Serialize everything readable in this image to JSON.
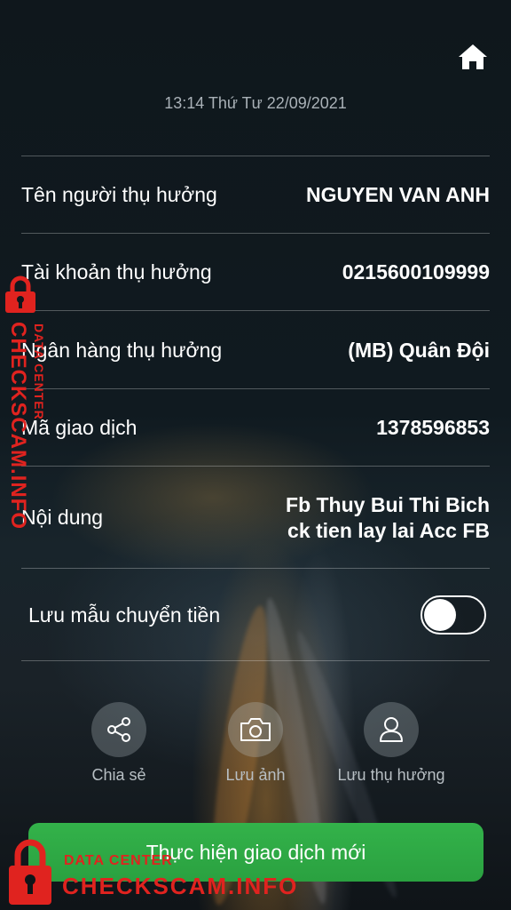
{
  "header": {
    "home_icon": "home-icon",
    "datetime": "13:14 Thứ Tư 22/09/2021"
  },
  "details": [
    {
      "label": "Tên người thụ hưởng",
      "value": "NGUYEN VAN ANH"
    },
    {
      "label": "Tài khoản thụ hưởng",
      "value": "0215600109999"
    },
    {
      "label": "Ngân hàng thụ hưởng",
      "value": "(MB) Quân Đội"
    },
    {
      "label": "Mã giao dịch",
      "value": "1378596853"
    },
    {
      "label": "Nội dung",
      "value_line1": "Fb Thuy Bui Thi Bich",
      "value_line2": "ck tien lay lai Acc FB"
    }
  ],
  "save_template": {
    "label": "Lưu mẫu chuyển tiền",
    "enabled": false
  },
  "actions": [
    {
      "icon": "share-icon",
      "label": "Chia sẻ"
    },
    {
      "icon": "camera-icon",
      "label": "Lưu ảnh"
    },
    {
      "icon": "user-icon",
      "label": "Lưu thụ hưởng"
    }
  ],
  "primary_button": {
    "label": "Thực hiện giao dịch mới",
    "color": "#2ea843"
  },
  "watermark": {
    "small": "DATA CENTER",
    "big": "CHECKSCAM.INFO",
    "color": "#e0231f"
  }
}
